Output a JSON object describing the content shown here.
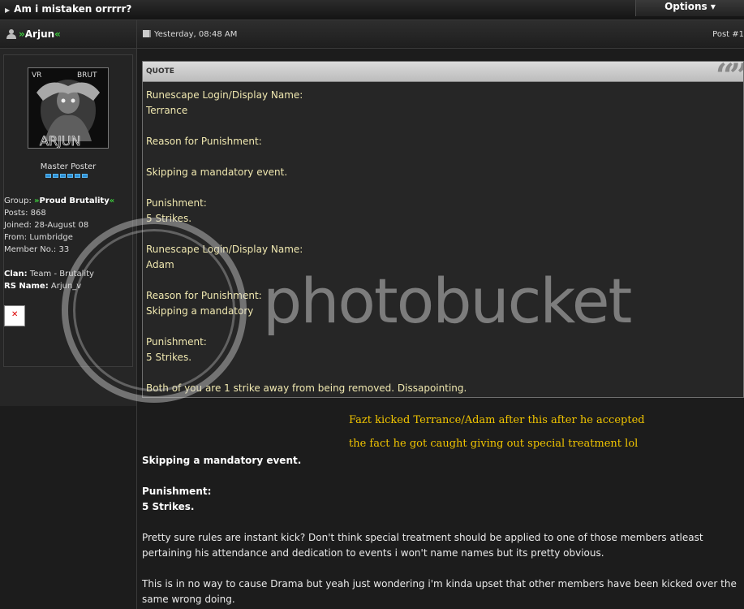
{
  "topic": {
    "title": "Am i mistaken orrrrr?",
    "options_label": "Options ▾"
  },
  "post": {
    "author": "Arjun",
    "author_prefix": "»",
    "author_suffix": "«",
    "date": "Yesterday, 08:48 AM",
    "post_number": "Post #1"
  },
  "profile": {
    "avatar_top_left": "VR",
    "avatar_top_right": "BRUT",
    "avatar_bottom": "ARJUN",
    "rank": "Master Poster",
    "rank_pips": 6,
    "group_label": "Group:",
    "group_prefix": "»",
    "group_name": "Proud Brutality",
    "group_suffix": "«",
    "posts": "Posts: 868",
    "joined": "Joined: 28-August 08",
    "from": "From: Lumbridge",
    "member_no": "Member No.: 33",
    "clan_label": "Clan:",
    "clan_value": "Team - Brutality",
    "rs_label": "RS Name:",
    "rs_value": "Arjun_v"
  },
  "quote": {
    "label": "QUOTE",
    "marks": "“”",
    "lines": [
      [
        "Runescape Login/Display Name:",
        "Terrance"
      ],
      [
        "Reason for Punishment:"
      ],
      [
        "Skipping a mandatory event."
      ],
      [
        "Punishment:",
        "5 Strikes."
      ],
      [
        "Runescape Login/Display Name:",
        "Adam"
      ],
      [
        "Reason for Punishment:",
        "Skipping a mandatory"
      ],
      [
        "Punishment:",
        "5 Strikes."
      ],
      [
        "Both of you are 1 strike away from being removed. Dissapointing."
      ]
    ]
  },
  "watermark": "photobucket",
  "annotation": [
    "Fazt kicked Terrance/Adam after this after he accepted",
    "the fact he got caught giving out special treatment lol"
  ],
  "body": {
    "bold1": "Skipping a mandatory event.",
    "bold2": "Punishment:",
    "bold3": "5 Strikes.",
    "para1": "Pretty sure rules are instant kick? Don't think special treatment should be applied to one of those members atleast pertaining his attendance and dedication to events i won't name names but its pretty obvious.",
    "para2": "This is in no way to cause Drama but yeah just wondering i'm kinda upset that other members have been kicked over the same wrong doing."
  },
  "colors": {
    "group_green": "#3ccc3c",
    "annotation_gold": "#f0c400",
    "pip_blue": "#2a8fd6"
  }
}
